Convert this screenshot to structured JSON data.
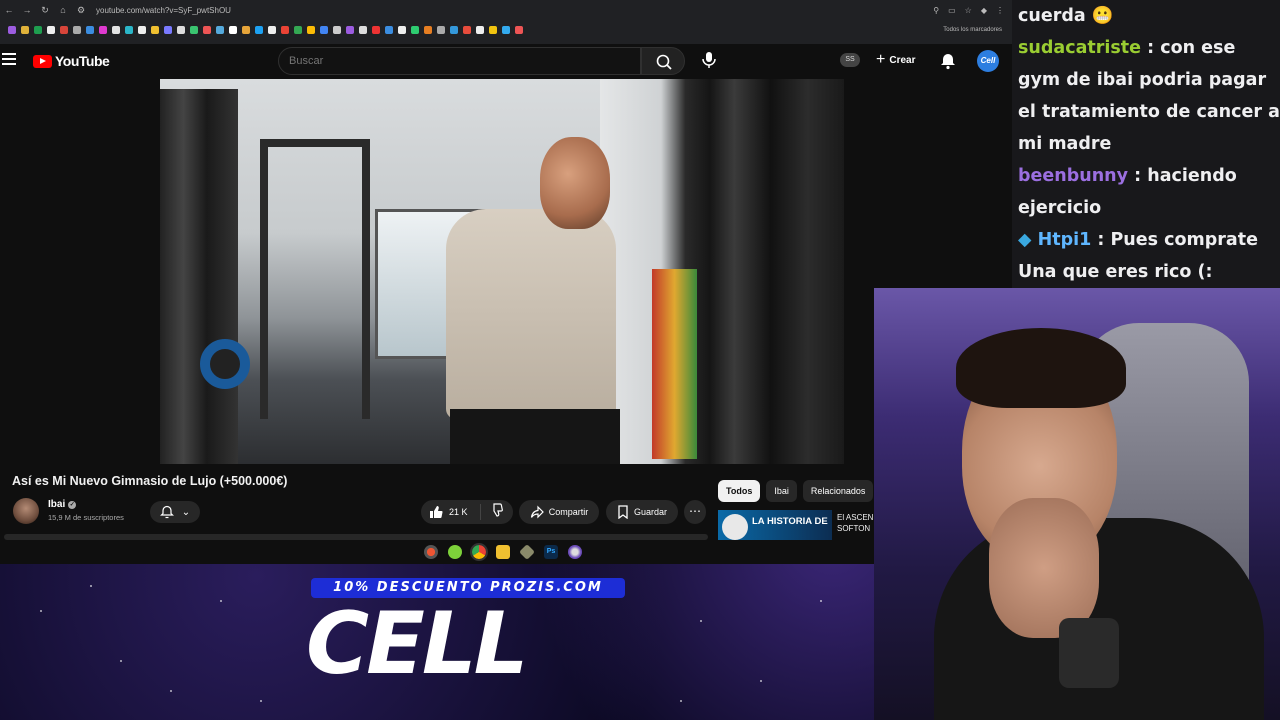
{
  "browser": {
    "url": "youtube.com/watch?v=SyF_pwtShOU",
    "bookmarks_all_label": "Todos los marcadores"
  },
  "youtube": {
    "logo_text": "YouTube",
    "search_placeholder": "Buscar",
    "ss_badge": "SS",
    "create_label": "Crear",
    "avatar_text": "Cell",
    "video": {
      "title": "Así es Mi Nuevo Gimnasio de Lujo (+500.000€)",
      "channel": "Ibai",
      "subscribers": "15,9 M de suscriptores",
      "likes": "21 K",
      "share_label": "Compartir",
      "save_label": "Guardar"
    },
    "chips": [
      "Todos",
      "Ibai",
      "Relacionados"
    ],
    "related": {
      "thumb_text": "LA HISTORIA DE",
      "title_line1": "El ASCEN",
      "title_line2": "SOFTON"
    }
  },
  "chat": {
    "messages": [
      {
        "user": "",
        "text": "cuerda 😬",
        "color": "#efeff1"
      },
      {
        "user": "sudacatriste",
        "text": " : con ese gym de ibai podria pagar el tratamiento de cancer a mi madre",
        "color": "#9acd32"
      },
      {
        "user": "beenbunny",
        "text": " : haciendo ejercicio",
        "color": "#9b6fe0"
      },
      {
        "user": "Htpi1",
        "text": " : Pues comprate Una que eres rico (:",
        "color": "#5fb6ff"
      }
    ]
  },
  "overlay": {
    "promo": "10% DESCUENTO PROZIS.COM",
    "brand": "CELL"
  },
  "colors": {
    "youtube_bg": "#0f0f0f",
    "brand_red": "#ff0000",
    "promo_blue": "#1d2dd6",
    "chat_bg": "#18181b"
  }
}
